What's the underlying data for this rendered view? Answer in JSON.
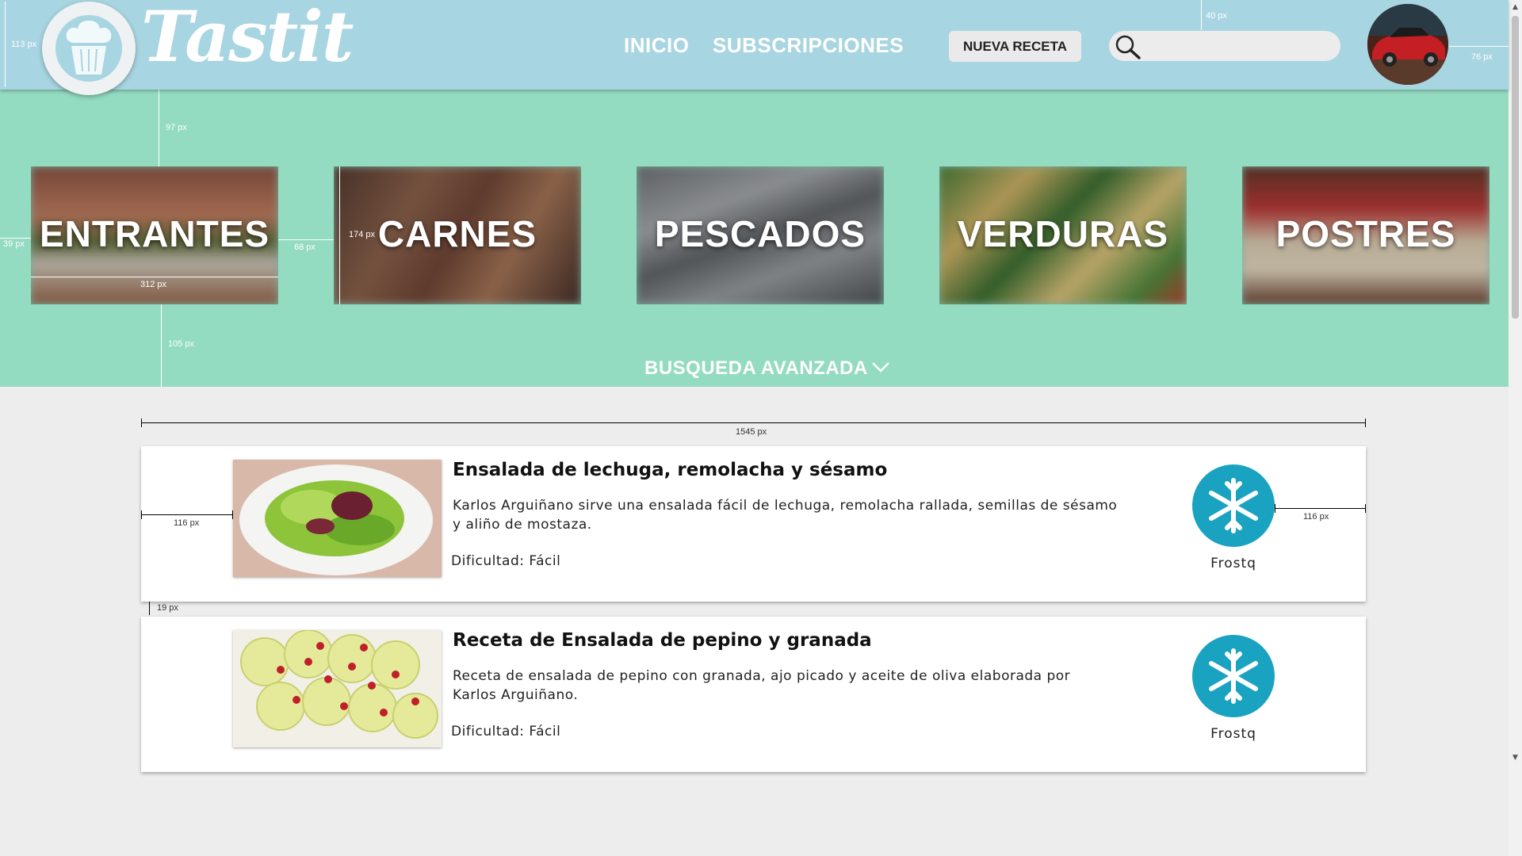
{
  "header": {
    "brand": "Tastit",
    "nav": {
      "home": "INICIO",
      "subscriptions": "SUBSCRIPCIONES"
    },
    "new_recipe_button": "NUEVA RECETA",
    "search_placeholder": "",
    "measures": {
      "header_height": "113 px",
      "search_gap": "40 px",
      "avatar_gap": "76 px"
    }
  },
  "categories": {
    "items": [
      "ENTRANTES",
      "CARNES",
      "PESCADOS",
      "VERDURAS",
      "POSTRES"
    ],
    "measures": {
      "top_gap": "97 px",
      "left_gap": "39 px",
      "tile_width": "312 px",
      "tile_gap": "68 px",
      "tile_height": "174 px",
      "bottom_gap": "105 px"
    },
    "advanced_search": "BUSQUEDA AVANZADA"
  },
  "recipes": {
    "measures": {
      "list_width": "1545 px",
      "left_padding": "116 px",
      "right_padding": "116 px",
      "card_gap": "19 px"
    },
    "items": [
      {
        "title": "Ensalada de lechuga, remolacha y sésamo",
        "description": "Karlos Arguiñano sirve una ensalada fácil de lechuga, remolacha rallada, semillas de sésamo y aliño de mostaza.",
        "difficulty": "Dificultad: Fácil",
        "badge": "Frostq",
        "badge_icon": "snowflake-icon"
      },
      {
        "title": "Receta de Ensalada de pepino y granada",
        "description": "Receta de ensalada de pepino con granada, ajo picado y aceite de oliva elaborada por Karlos Arguiñano.",
        "difficulty": "Dificultad: Fácil",
        "badge": "Frostq",
        "badge_icon": "snowflake-icon"
      }
    ]
  },
  "colors": {
    "header": "#a8d5e2",
    "category_band": "#93dbc1",
    "badge": "#1aa3c0",
    "background": "#ededed"
  }
}
